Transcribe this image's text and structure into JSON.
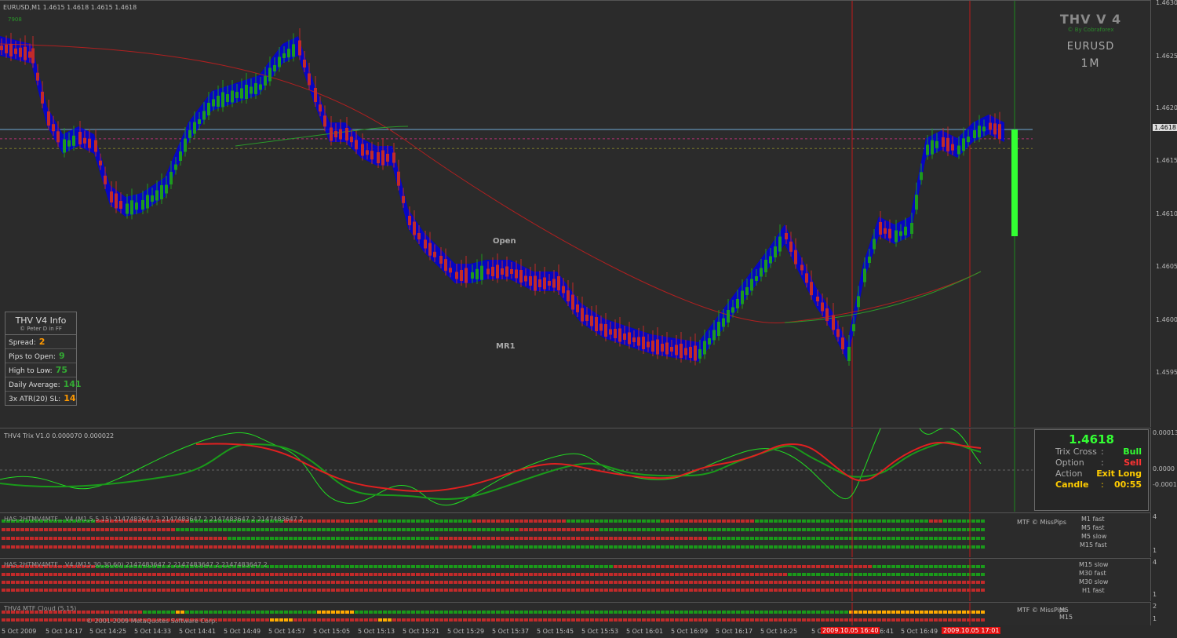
{
  "main": {
    "header": "EURUSD,M1  1.4615 1.4618 1.4615 1.4618",
    "corner_tag": "7908",
    "brand": {
      "title": "THV V 4",
      "by": "© By Cobraforex",
      "pair": "EURUSD",
      "timeframe": "1M"
    },
    "labels": {
      "open": "Open",
      "mr1": "MR1"
    },
    "price_axis": [
      "1.4630",
      "1.4625",
      "1.4620",
      "1.4618",
      "1.4615",
      "1.4610",
      "1.4605",
      "1.4600",
      "1.4595"
    ],
    "current_price": 1.4618,
    "open_level": 1.46092,
    "mr1_level": 1.46
  },
  "info_panel": {
    "title": "THV  V4  Info",
    "subtitle": "© Peter D in FF",
    "rows": [
      {
        "label": "Spread:",
        "value": "2",
        "color": "#ff9900"
      },
      {
        "label": "Pips to Open:",
        "value": "9",
        "color": "#33aa33"
      },
      {
        "label": "High to Low:",
        "value": "75",
        "color": "#33aa33"
      },
      {
        "label": "Daily Average:",
        "value": "141",
        "color": "#33aa33"
      },
      {
        "label": "3x ATR(20) SL:",
        "value": "14",
        "color": "#ff9900"
      }
    ]
  },
  "trix": {
    "header": "THV4 Trix V1.0  0.000070  0.000022",
    "axis": [
      "0.00013",
      "0.0000",
      "-0.0001"
    ],
    "box": {
      "price": "1.4618",
      "rows": [
        {
          "label": "Trix Cross",
          "sep": ":",
          "value": "Bull",
          "color": "#33ff33"
        },
        {
          "label": "Option",
          "sep": ":",
          "value": "Sell",
          "color": "#ff3333"
        },
        {
          "label": "Action",
          "sep": ":",
          "value": "Exit Long",
          "color": "#ffcc00"
        },
        {
          "label": "Candle",
          "sep": ":",
          "value": "00:55",
          "color": "#ffcc00"
        }
      ]
    }
  },
  "mtf1": {
    "header": "HAS 2HTMV4MTF... V4 (M1,5,5,15) 2147483647 3 2147483647 2 2147483647 2 2147483647 2",
    "brand": "MTF © MissPips",
    "labels": [
      "M1 fast",
      "M5 fast",
      "M5 slow",
      "M15 fast"
    ],
    "axis": [
      "4",
      "1"
    ]
  },
  "mtf2": {
    "header": "HAS 2HTMV4MTF... V4 (M15,30,30,60) 2147483647 2 2147483647 2 2147483647 2",
    "labels": [
      "M15 slow",
      "M30 fast",
      "M30 slow",
      "H1 fast"
    ],
    "axis": [
      "4",
      "1"
    ]
  },
  "mtf3": {
    "header": "THV4 MTF Cloud (5,15)",
    "brand": "MTF © MissPips",
    "labels": [
      "M5",
      "M15"
    ],
    "footer": "© 2001-2009 MetaQuotes Software Corp.",
    "axis": [
      "2",
      "1"
    ]
  },
  "time_axis": [
    "5 Oct 2009",
    "5 Oct 14:17",
    "5 Oct 14:25",
    "5 Oct 14:33",
    "5 Oct 14:41",
    "5 Oct 14:49",
    "5 Oct 14:57",
    "5 Oct 15:05",
    "5 Oct 15:13",
    "5 Oct 15:21",
    "5 Oct 15:29",
    "5 Oct 15:37",
    "5 Oct 15:45",
    "5 Oct 15:53",
    "5 Oct 16:01",
    "5 Oct 16:09",
    "5 Oct 16:17",
    "5 Oct 16:25",
    "5 Oct 16:33",
    "5 Oct 16:41",
    "5 Oct 16:49"
  ],
  "time_markers": [
    "2009.10.05 16:40",
    "2009.10.05 17:01"
  ],
  "colors": {
    "bull": "#1e9a1e",
    "bear": "#c22a2a",
    "cloud": "#0000dd",
    "price_line": "#6fa8d6"
  }
}
